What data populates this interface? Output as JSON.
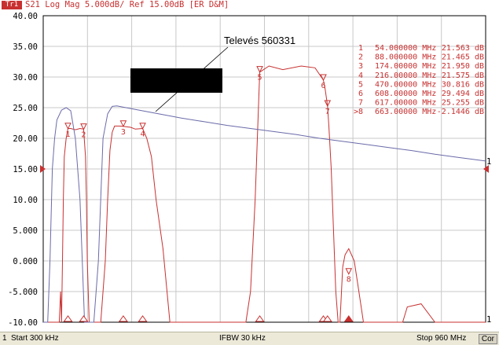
{
  "header": {
    "trace_badge": "Tr1",
    "text": "S21 Log Mag 5.000dB/ Ref 15.00dB [ER D&M]"
  },
  "footer": {
    "channel": "1",
    "start": "Start 300 kHz",
    "ifbw": "IFBW 30 kHz",
    "stop": "Stop 960 MHz",
    "cor": "Cor"
  },
  "chart_data": {
    "type": "line",
    "title": "",
    "xlabel": "",
    "ylabel": "",
    "xlim": [
      0.3,
      960
    ],
    "ylim": [
      -10,
      40
    ],
    "y_ticks": [
      "40.00",
      "35.00",
      "30.00",
      "25.00",
      "20.00",
      "15.00",
      "10.00",
      "5.000",
      "0.000",
      "-5.000",
      "-10.00"
    ],
    "reference_level": 15,
    "grid": true,
    "annotation": "Televés 560331",
    "series": [
      {
        "name": "",
        "color": "#c83030",
        "x": [
          0.3,
          20,
          30,
          35,
          38,
          40,
          42,
          44,
          46,
          50,
          54,
          60,
          70,
          80,
          88,
          92,
          94,
          96,
          98,
          100,
          105,
          110,
          115,
          125,
          130,
          135,
          140,
          145,
          150,
          155,
          165,
          174,
          190,
          200,
          216,
          225,
          235,
          245,
          260,
          275,
          290,
          300,
          320,
          340,
          360,
          380,
          400,
          420,
          440,
          450,
          460,
          470,
          490,
          520,
          560,
          590,
          608,
          612,
          617,
          620,
          625,
          630,
          635,
          640,
          644,
          646,
          650,
          655,
          663,
          675,
          685,
          695,
          705,
          715,
          725,
          740,
          760,
          780,
          790,
          820,
          850,
          880,
          900,
          960
        ],
        "y": [
          -10,
          -10,
          -10,
          -10,
          -5,
          -10,
          0,
          10,
          17,
          20,
          21.6,
          21.6,
          21.4,
          21.6,
          21.5,
          17,
          10,
          0,
          -5,
          -10,
          -10,
          -10,
          -10,
          -10,
          -5,
          0,
          10,
          18,
          21,
          22,
          22,
          21.95,
          21.8,
          21.5,
          21.6,
          20,
          17,
          10,
          2,
          -10,
          -10,
          -10,
          -10,
          -10,
          -10,
          -10,
          -10,
          -10,
          -10,
          -5,
          10,
          30.8,
          31.8,
          31.2,
          31.8,
          31.5,
          29.5,
          28,
          25.3,
          22,
          15,
          5,
          -5,
          -10,
          -10,
          -7,
          -1,
          1,
          2,
          0,
          -5,
          -10,
          -10,
          -10,
          -10,
          -10,
          -10,
          -10,
          -7.5,
          -7,
          -10,
          -10,
          -10,
          -10
        ]
      },
      {
        "name": "",
        "color": "#6a6aaa",
        "x": [
          0.3,
          10,
          15,
          20,
          25,
          30,
          40,
          50,
          60,
          70,
          80,
          90,
          100,
          110,
          120,
          130,
          140,
          150,
          160,
          180,
          200,
          250,
          300,
          350,
          400,
          450,
          500,
          550,
          600,
          650,
          700,
          750,
          800,
          850,
          900,
          960
        ],
        "y": [
          -10,
          -10,
          0,
          15,
          20,
          23,
          24.6,
          25,
          24.5,
          20,
          10,
          -10,
          -10,
          -10,
          0,
          20,
          24,
          25.2,
          25.3,
          25,
          24.7,
          24,
          23.3,
          22.7,
          22.1,
          21.6,
          21.1,
          20.6,
          20,
          19.5,
          19,
          18.5,
          18,
          17.4,
          16.9,
          16.3
        ]
      }
    ],
    "markers": [
      {
        "label": "1",
        "freq": "54.000000 MHz",
        "value": "21.563 dB",
        "x": 54,
        "y": 21.563
      },
      {
        "label": "2",
        "freq": "88.000000 MHz",
        "value": "21.465 dB",
        "x": 88,
        "y": 21.465
      },
      {
        "label": "3",
        "freq": "174.00000 MHz",
        "value": "21.950 dB",
        "x": 174,
        "y": 21.95
      },
      {
        "label": "4",
        "freq": "216.00000 MHz",
        "value": "21.575 dB",
        "x": 216,
        "y": 21.575
      },
      {
        "label": "5",
        "freq": "470.00000 MHz",
        "value": "30.816 dB",
        "x": 470,
        "y": 30.816
      },
      {
        "label": "6",
        "freq": "608.00000 MHz",
        "value": "29.494 dB",
        "x": 608,
        "y": 29.494
      },
      {
        "label": "7",
        "freq": "617.00000 MHz",
        "value": "25.255 dB",
        "x": 617,
        "y": 25.255
      },
      {
        "label": "8",
        "freq": "663.00000 MHz",
        "value": "-2.1446 dB",
        "x": 663,
        "y": -2.1446
      }
    ],
    "active_marker_prefix": ">"
  }
}
